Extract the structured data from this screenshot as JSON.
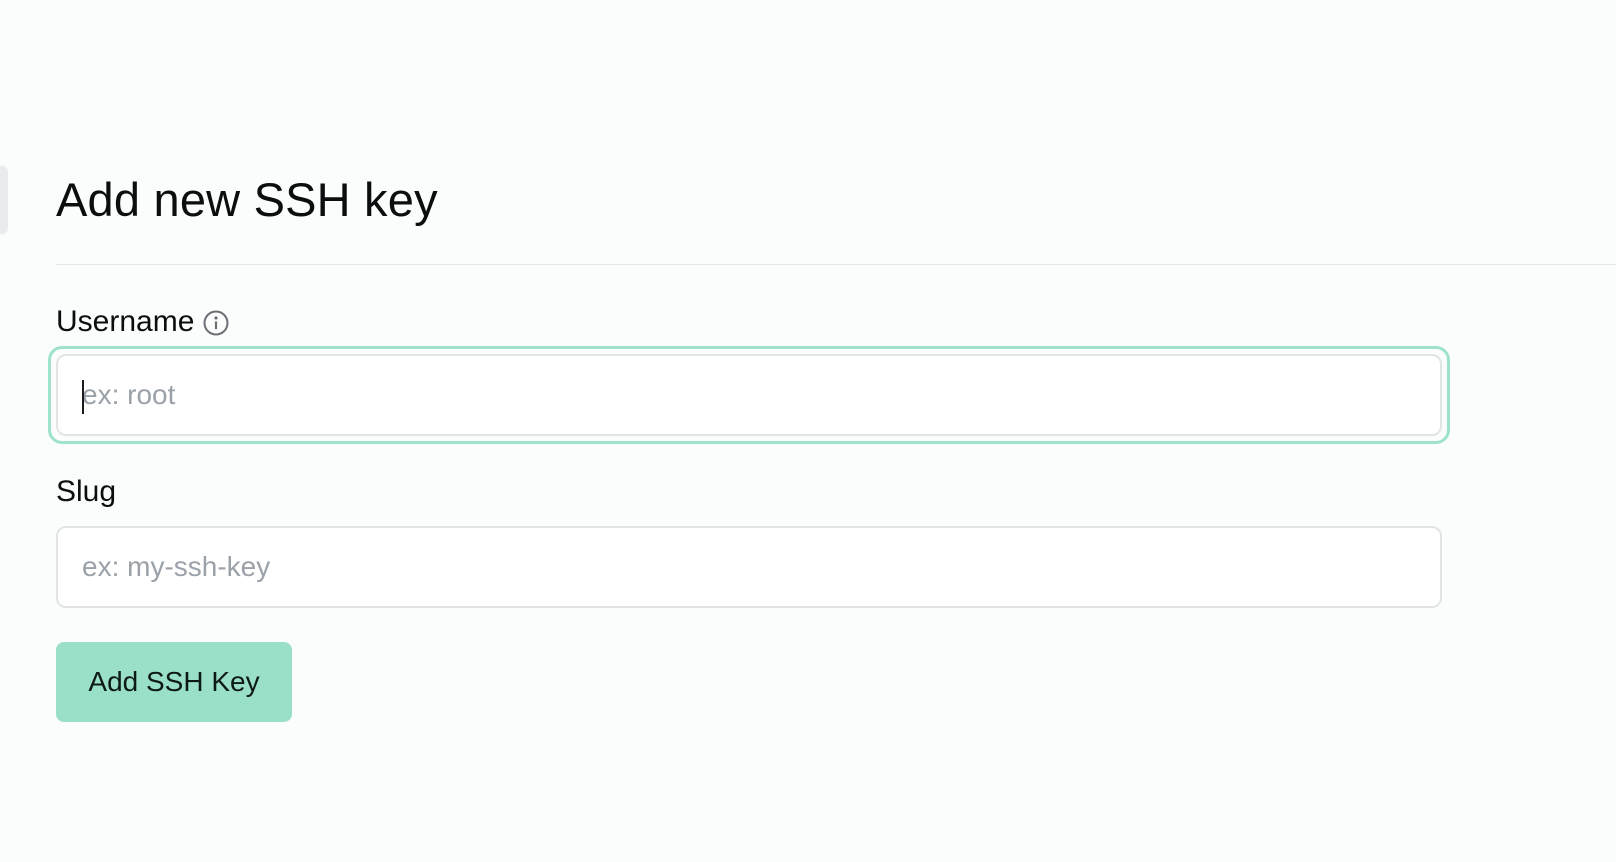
{
  "form": {
    "title": "Add new SSH key",
    "fields": [
      {
        "label": "Username",
        "placeholder": "ex: root",
        "value": "",
        "has_info_icon": true,
        "info_icon": "info-circle-icon",
        "focused": true
      },
      {
        "label": "Slug",
        "placeholder": "ex: my-ssh-key",
        "value": "",
        "has_info_icon": false,
        "focused": false
      }
    ],
    "submit_label": "Add SSH Key"
  },
  "colors": {
    "accent": "#9ae0c9",
    "focus_ring": "#9ee2cb",
    "placeholder": "#9aa1a9",
    "text": "#0b0d0e",
    "background": "#fbfcfc"
  }
}
